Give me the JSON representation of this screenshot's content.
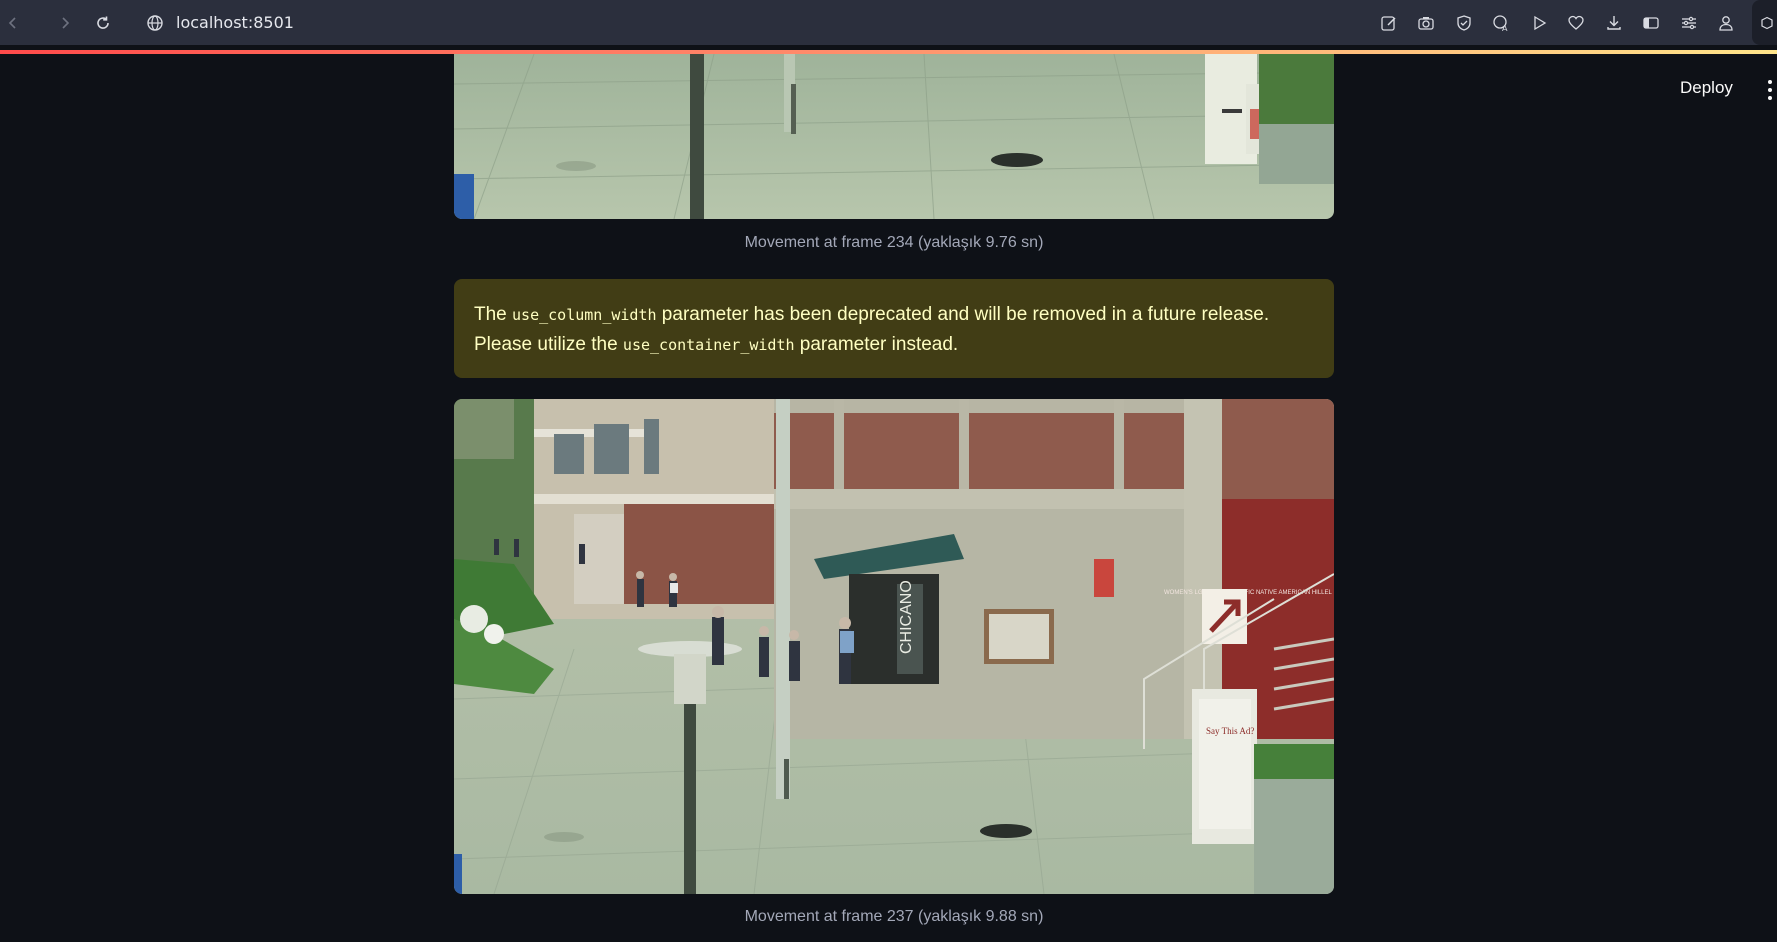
{
  "browser": {
    "url": "localhost:8501",
    "icons": [
      "back-icon",
      "forward-icon",
      "reload-icon",
      "globe-icon",
      "edit-icon",
      "camera-icon",
      "shield-icon",
      "translate-icon",
      "play-icon",
      "heart-icon",
      "download-icon",
      "sidebar-icon",
      "settings-icon",
      "profile-icon",
      "extension-icon"
    ]
  },
  "header": {
    "deploy_label": "Deploy"
  },
  "frames": [
    {
      "caption": "Movement at frame 234 (yaklaşık 9.76 sn)"
    },
    {
      "caption": "Movement at frame 237 (yaklaşık 9.88 sn)"
    }
  ],
  "warning": {
    "text_1": "The ",
    "code_1": "use_column_width",
    "text_2": " parameter has been deprecated and will be removed in a future release. Please utilize the ",
    "code_2": "use_container_width",
    "text_3": " parameter instead."
  },
  "scene_text": {
    "building_sign": "CHICANO",
    "wall_sign": "WOMEN'S LGBT ASIAN PACIFIC NATIVE AMERICAN HILLEL",
    "kiosk_sign": "Say This Ad?"
  },
  "colors": {
    "app_bg": "#0e1117",
    "warning_bg": "#413d15",
    "warning_text": "#ffffc2",
    "browser_bar": "#2b2f3d"
  }
}
